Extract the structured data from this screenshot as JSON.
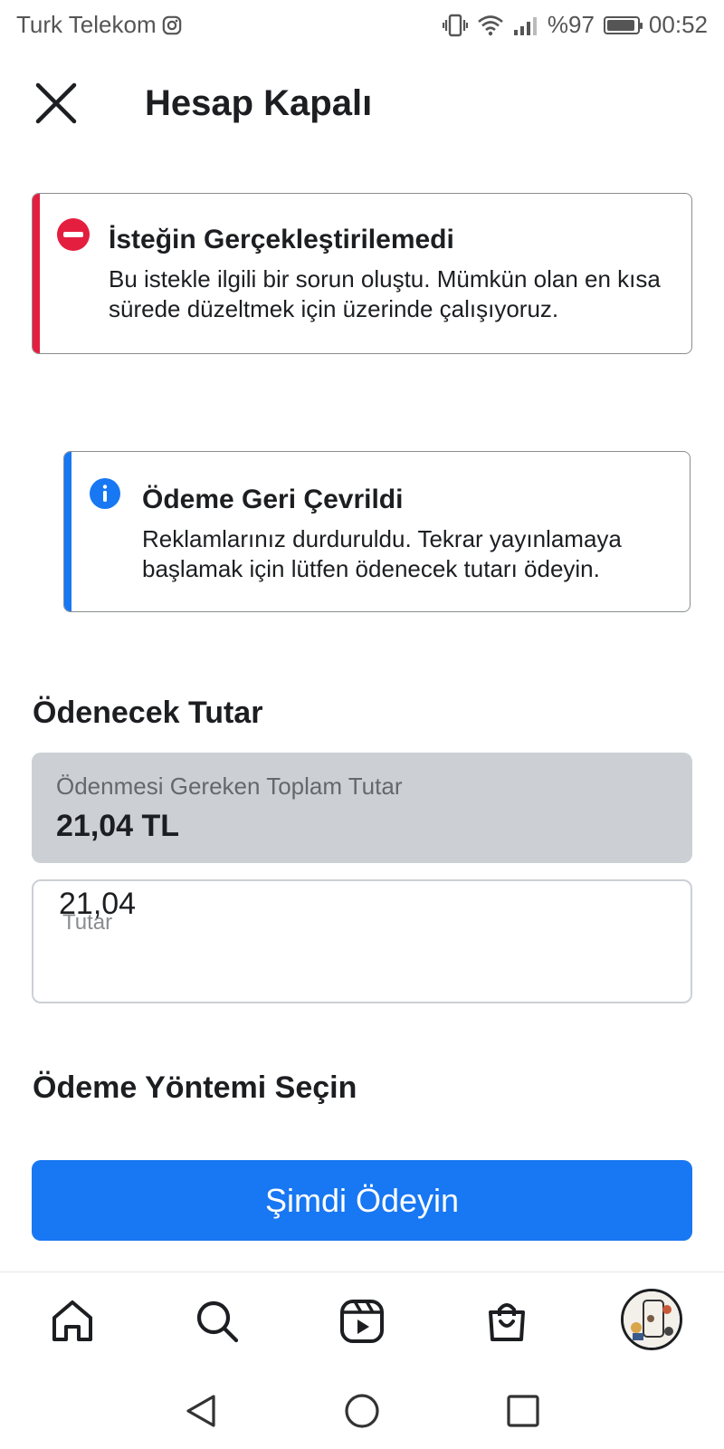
{
  "status_bar": {
    "carrier": "Turk Telekom",
    "battery": "%97",
    "time": "00:52"
  },
  "header": {
    "title": "Hesap Kapalı"
  },
  "error_alert": {
    "title": "İsteğin Gerçekleştirilemedi",
    "body": "Bu istekle ilgili bir sorun oluştu. Mümkün olan en kısa sürede düzeltmek için üzerinde çalışıyoruz.",
    "accent_color": "#e41e3f"
  },
  "info_alert": {
    "title": "Ödeme Geri Çevrildi",
    "body": "Reklamlarınız durduruldu. Tekrar yayınlamaya başlamak için lütfen ödenecek tutarı ödeyin.",
    "accent_color": "#1877f2"
  },
  "amount_section": {
    "heading": "Ödenecek Tutar",
    "total_label": "Ödenmesi Gereken Toplam Tutar",
    "total_value": "21,04 TL",
    "field_placeholder": "Tutar",
    "field_value": "21,04"
  },
  "payment_method": {
    "heading": "Ödeme Yöntemi Seçin"
  },
  "pay_button": {
    "label": "Şimdi Ödeyin",
    "color": "#1877f2"
  },
  "bottom_nav": {
    "items": [
      "home-icon",
      "search-icon",
      "reels-icon",
      "shop-icon",
      "profile-avatar"
    ]
  },
  "system_nav": {
    "items": [
      "back-icon",
      "home-circle-icon",
      "recents-icon"
    ]
  }
}
